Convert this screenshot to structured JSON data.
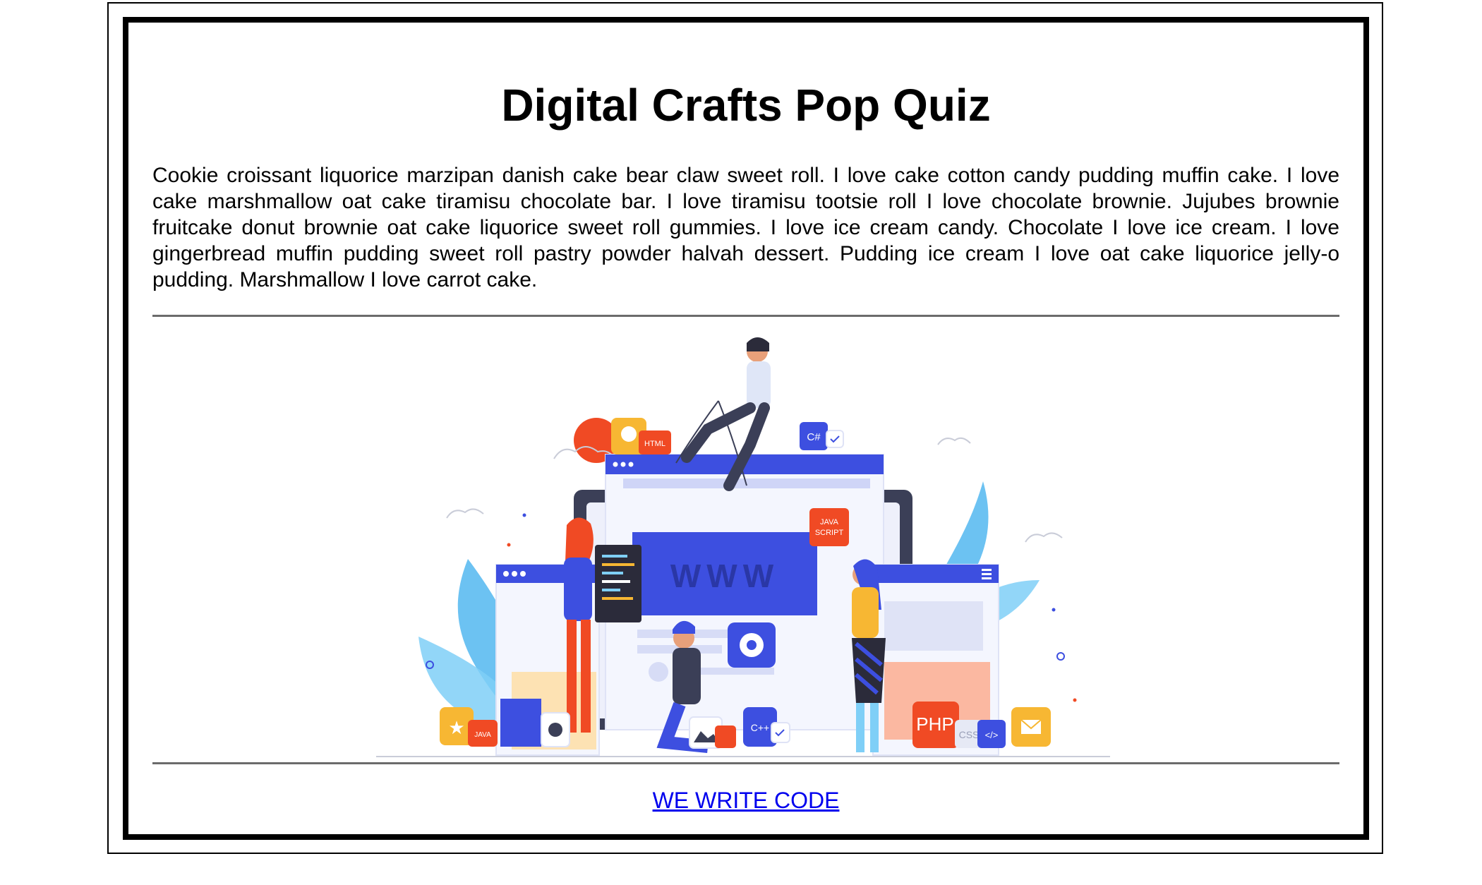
{
  "page": {
    "title": "Digital Crafts Pop Quiz",
    "paragraph": "Cookie croissant liquorice marzipan danish cake bear claw sweet roll. I love cake cotton candy pudding muffin cake. I love cake marshmallow oat cake tiramisu chocolate bar. I love tiramisu tootsie roll I love chocolate brownie. Jujubes brownie fruitcake donut brownie oat cake liquorice sweet roll gummies. I love ice cream candy. Chocolate I love ice cream. I love gingerbread muffin pudding sweet roll pastry powder halvah dessert. Pudding ice cream I love oat cake liquorice jelly-o pudding. Marshmallow I love carrot cake.",
    "link_text": "WE WRITE CODE"
  },
  "illustration": {
    "www_label": "WWW",
    "badges": {
      "html": "HTML",
      "csharp": "C#",
      "javascript_line1": "JAVA",
      "javascript_line2": "SCRIPT",
      "java": "JAVA",
      "php": "PHP",
      "cpp": "C++",
      "css": "CSS",
      "code_tag": "</>"
    }
  },
  "colors": {
    "link": "#0000ee",
    "divider": "#6b6b6b",
    "accent_blue": "#3d4fe0",
    "accent_red": "#f04a24",
    "accent_yellow": "#f7b733"
  }
}
